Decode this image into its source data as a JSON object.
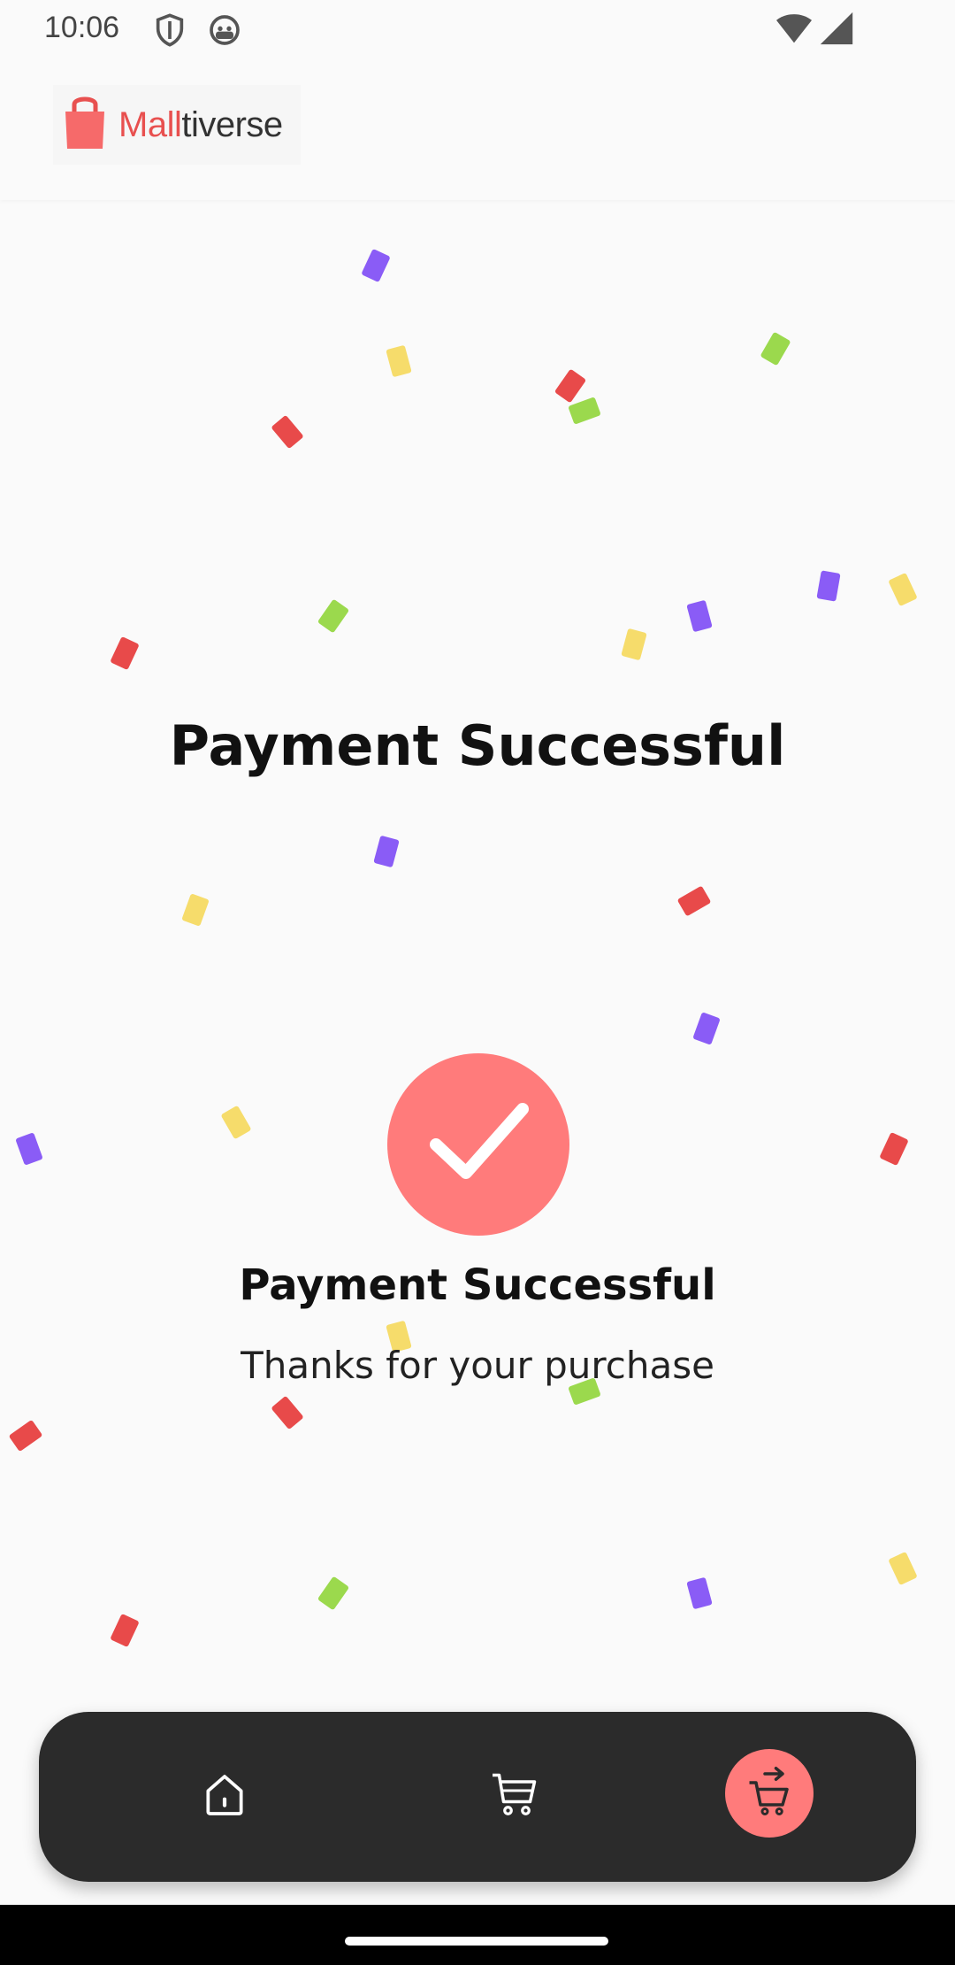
{
  "status_bar": {
    "time": "10:06",
    "icons": [
      "shield-icon",
      "android-face-icon",
      "wifi-icon",
      "cell-signal-icon"
    ]
  },
  "header": {
    "logo_accent": "Mall",
    "logo_rest": "tiverse"
  },
  "main": {
    "title": "Payment Successful",
    "confirmation_title": "Payment Successful",
    "confirmation_subtitle": "Thanks for your purchase"
  },
  "bottom_nav": {
    "items": [
      {
        "icon": "home-icon"
      },
      {
        "icon": "cart-icon"
      },
      {
        "icon": "checkout-cart-icon",
        "active": true
      }
    ]
  },
  "colors": {
    "accent": "#ff7b7b",
    "brand_red": "#e8504f",
    "nav_bg": "#2b2b2b",
    "confetti": [
      "#8a5cf6",
      "#f6dc6b",
      "#e84a4a",
      "#9bd94d"
    ]
  }
}
